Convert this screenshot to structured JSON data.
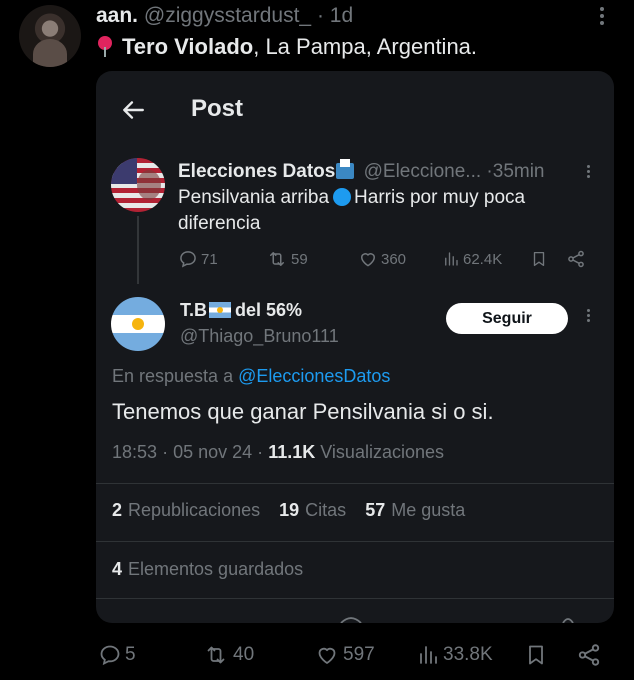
{
  "outer_post": {
    "author_name": "aan.",
    "handle": "@ziggysstardust_",
    "dot": "·",
    "time": "1d",
    "location_bold": "Tero Violado",
    "location_rest": ", La Pampa, Argentina.",
    "actions": {
      "replies": "5",
      "reposts": "40",
      "likes": "597",
      "views": "33.8K"
    }
  },
  "embedded": {
    "title": "Post",
    "quoted": {
      "author_name": "Elecciones Datos",
      "handle": "@Eleccione...",
      "dot": "·",
      "time": "35min",
      "text_before": "Pensilvania arriba",
      "text_after": "Harris por muy poca diferencia",
      "actions": {
        "replies": "71",
        "reposts": "59",
        "likes": "360",
        "views": "62.4K"
      }
    },
    "reply": {
      "author_name_prefix": "T.B",
      "author_name_suffix": "del 56%",
      "handle": "@Thiago_Bruno111",
      "follow_label": "Seguir",
      "reply_to_label": "En respuesta a",
      "reply_to_handle": "@EleccionesDatos",
      "text": "Tenemos que ganar Pensilvania si o si.",
      "time": "18:53",
      "sep1": "·",
      "date": "05 nov 24",
      "sep2": "·",
      "views_count": "11.1K",
      "views_label": "Visualizaciones",
      "reposts_count": "2",
      "reposts_label": "Republicaciones",
      "quotes_count": "19",
      "quotes_label": "Citas",
      "likes_count": "57",
      "likes_label": "Me gusta",
      "saved_count": "4",
      "saved_label": "Elementos guardados"
    }
  },
  "colors": {
    "background": "#000000",
    "card": "#16181c",
    "accent": "#1d9bf0",
    "muted": "#71767b",
    "text": "#e7e9ea"
  },
  "icons": [
    "pin-icon",
    "back-arrow-icon",
    "ballot-box-icon",
    "blue-circle-icon",
    "argentina-flag-icon",
    "reply-icon",
    "repost-icon",
    "like-icon",
    "views-icon",
    "bookmark-icon",
    "share-icon",
    "more-icon"
  ]
}
